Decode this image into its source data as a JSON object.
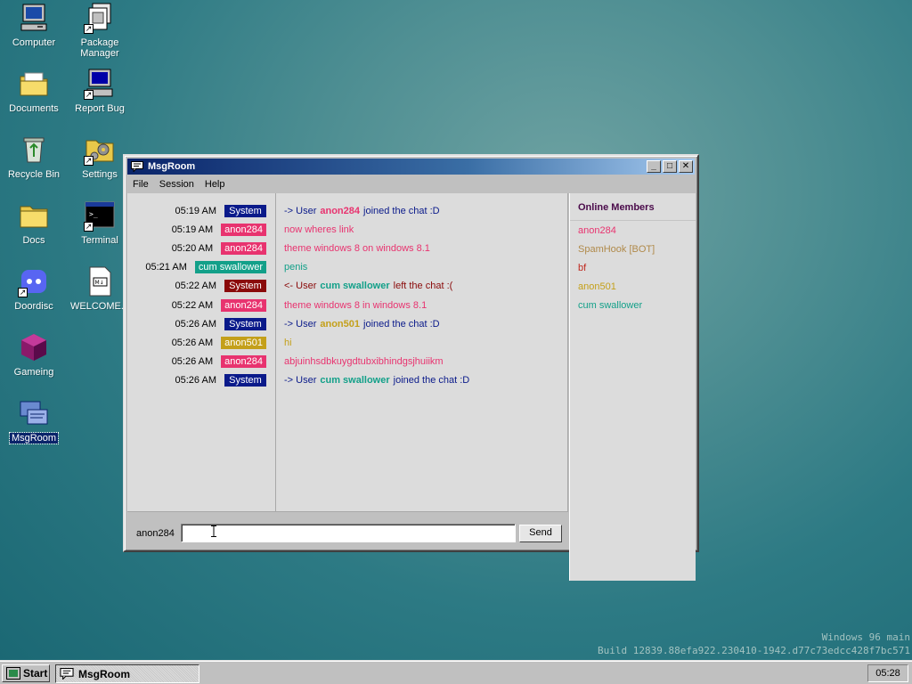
{
  "desktop": {
    "icons": [
      {
        "label": "Computer",
        "icon": "computer-icon"
      },
      {
        "label": "Package Manager",
        "icon": "package-manager-icon"
      },
      {
        "label": "Documents",
        "icon": "documents-folder-icon"
      },
      {
        "label": "Report Bug",
        "icon": "report-bug-icon"
      },
      {
        "label": "Recycle Bin",
        "icon": "recycle-bin-icon"
      },
      {
        "label": "Settings",
        "icon": "settings-icon"
      },
      {
        "label": "Docs",
        "icon": "docs-folder-icon"
      },
      {
        "label": "Terminal",
        "icon": "terminal-icon"
      },
      {
        "label": "Doordisc",
        "icon": "doordisc-icon"
      },
      {
        "label": "WELCOME...",
        "icon": "markdown-file-icon"
      },
      {
        "label": "Gameing",
        "icon": "gameing-icon"
      },
      {
        "label": "MsgRoom",
        "icon": "msgroom-icon"
      }
    ],
    "package_manager_line1": "Package",
    "package_manager_line2": "Manager"
  },
  "window": {
    "title": "MsgRoom",
    "menu": [
      "File",
      "Session",
      "Help"
    ],
    "minimize": "_",
    "maximize": "□",
    "close": "✕"
  },
  "colors": {
    "system": "#0a1a8a",
    "system_leave": "#8a0a0a",
    "anon284": "#e8336f",
    "cum_swallower": "#13a089",
    "anon501": "#c4a01a",
    "bf": "#c0281e",
    "spamhook": "#b08a4a"
  },
  "messages": [
    {
      "time": "05:19 AM",
      "user": "System",
      "kind": "system",
      "prefix": "-> User",
      "name": "anon284",
      "suffix": "joined the chat :D"
    },
    {
      "time": "05:19 AM",
      "user": "anon284",
      "kind": "anon284",
      "text": "now wheres link"
    },
    {
      "time": "05:20 AM",
      "user": "anon284",
      "kind": "anon284",
      "text": "theme windows 8 on windows 8.1"
    },
    {
      "time": "05:21 AM",
      "user": "cum swallower",
      "kind": "cum_swallower",
      "text": "penis"
    },
    {
      "time": "05:22 AM",
      "user": "System",
      "kind": "system_leave",
      "prefix": "<- User",
      "name": "cum swallower",
      "suffix": "left the chat :("
    },
    {
      "time": "05:22 AM",
      "user": "anon284",
      "kind": "anon284",
      "text": "theme windows 8 in windows 8.1"
    },
    {
      "time": "05:26 AM",
      "user": "System",
      "kind": "system",
      "prefix": "-> User",
      "name": "anon501",
      "suffix": "joined the chat :D"
    },
    {
      "time": "05:26 AM",
      "user": "anon501",
      "kind": "anon501",
      "text": "hi"
    },
    {
      "time": "05:26 AM",
      "user": "anon284",
      "kind": "anon284",
      "text": "abjuinhsdbkuygdtubxibhindgsjhuiikm"
    },
    {
      "time": "05:26 AM",
      "user": "System",
      "kind": "system",
      "prefix": "-> User",
      "name": "cum swallower",
      "suffix": "joined the chat :D"
    }
  ],
  "members": {
    "title": "Online Members",
    "list": [
      {
        "name": "anon284",
        "kind": "anon284"
      },
      {
        "name": "SpamHook [BOT]",
        "kind": "spamhook"
      },
      {
        "name": "bf",
        "kind": "bf"
      },
      {
        "name": "anon501",
        "kind": "anon501"
      },
      {
        "name": "cum swallower",
        "kind": "cum_swallower"
      }
    ]
  },
  "composer": {
    "nick": "anon284",
    "value": "",
    "send_label": "Send"
  },
  "watermark": {
    "line1": "Windows 96 main",
    "line2": "Build 12839.88efa922.230410-1942.d77c73edcc428f7bc571"
  },
  "taskbar": {
    "start_label": "Start",
    "task_label": "MsgRoom",
    "clock": "05:28"
  }
}
